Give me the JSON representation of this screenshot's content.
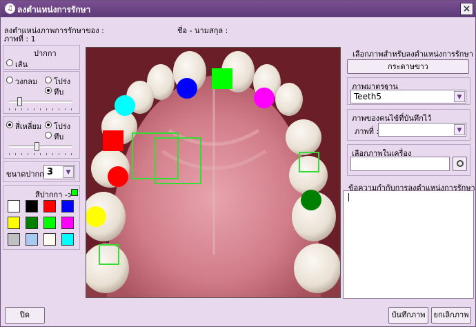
{
  "window": {
    "title": "ลงตำแหน่งการรักษา",
    "close": "×"
  },
  "header": {
    "position_label": "ลงตำแหน่งภาพการรักษาของ :",
    "name_label": "ชื่อ - นามสกุล :",
    "image_label": "ภาพที่ : 1"
  },
  "pen": {
    "heading": "ปากกา",
    "line_label": "เส้น",
    "circle_label": "วงกลม",
    "transparent_label": "โปร่ง",
    "solid_label": "ทึบ",
    "square_label": "สี่เหลี่ยม",
    "transparent_label2": "โปร่ง",
    "solid_label2": "ทึบ",
    "size_label": "ขนาดปากกา",
    "size_value": "3",
    "color_label": "สีปากกา ->",
    "current_color": "#00ff00",
    "palette": [
      "#ffffff",
      "#000000",
      "#ff0000",
      "#0000ff",
      "#ffff00",
      "#008000",
      "#00ff00",
      "#ff00ff",
      "#c0c0c0",
      "#a6caf0",
      "#fffbf0",
      "#00ffff"
    ]
  },
  "right": {
    "choose_heading": "เลือกภาพสำหรับลงตำแหน่งการรักษา",
    "whiteboard_button": "กระดาษขาว",
    "standard_heading": "ภาพมาตรฐาน",
    "standard_value": "Teeth5",
    "saved_heading": "ภาพของคนไข้ที่บันทึกไว้",
    "saved_image_label": "ภาพที่ :",
    "local_heading": "เลือกภาพในเครื่อง",
    "notes_heading": "ข้อความกำกับการลงตำแหน่งการรักษา"
  },
  "footer": {
    "close_button": "ปิด",
    "save_button": "บันทึกภาพ",
    "cancel_button": "ยกเลิกภาพ"
  },
  "marks": {
    "circles": [
      "#00ffff",
      "#0000ff",
      "#ff00ff",
      "#ff0000",
      "#ffff00",
      "#008000"
    ],
    "squares_solid": [
      "#00ff00",
      "#ff0000"
    ],
    "squares_outline": "#33dd33"
  }
}
